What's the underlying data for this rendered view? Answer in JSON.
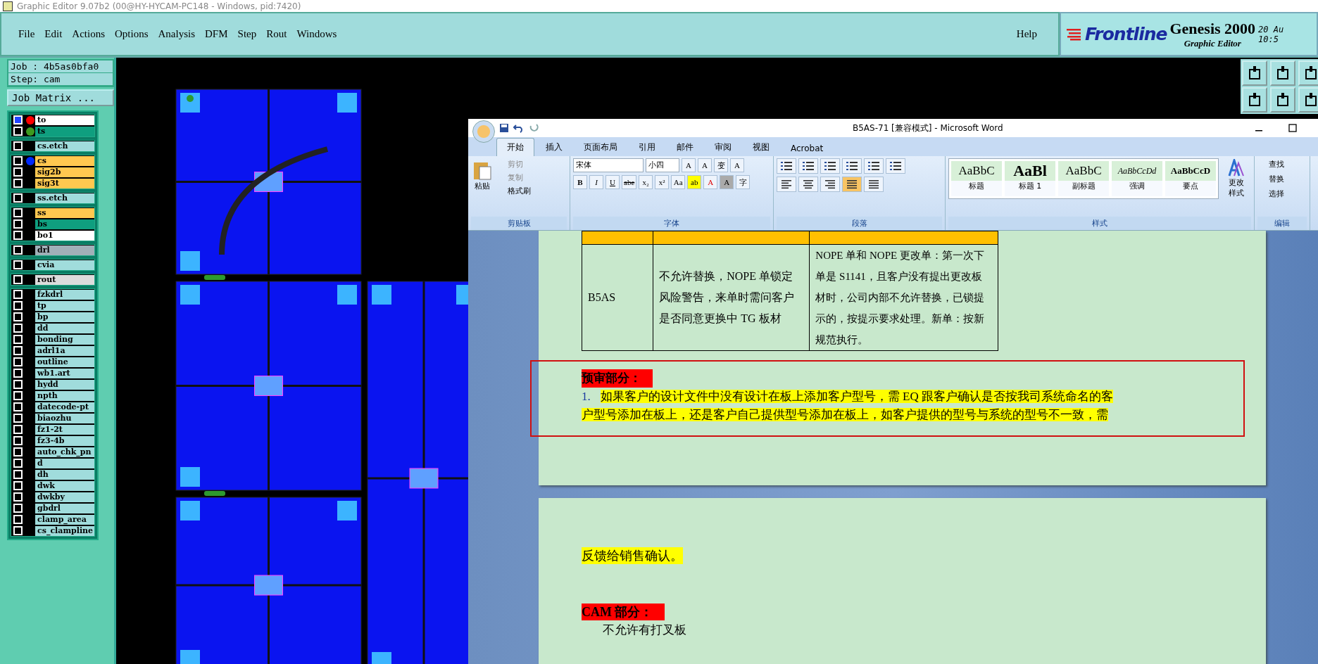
{
  "window": {
    "title": "Graphic Editor 9.07b2 (00@HY-HYCAM-PC148 - Windows, pid:7420)"
  },
  "menu": [
    "File",
    "Edit",
    "Actions",
    "Options",
    "Analysis",
    "DFM",
    "Step",
    "Rout",
    "Windows"
  ],
  "help": "Help",
  "brand": {
    "logo": "Frontline",
    "product": "Genesis 2000",
    "subtitle": "Graphic Editor",
    "date": "20 Au",
    "time": "10:5"
  },
  "job": {
    "job": "Job : 4b5as0bfa0",
    "step": "Step: cam",
    "matrix_button": "Job Matrix ..."
  },
  "layer_groups": [
    {
      "layers": [
        {
          "name": "to",
          "color": "#ffffff",
          "dot": {
            "color": "#ff0000"
          },
          "selected": true
        },
        {
          "name": "ts",
          "color": "#0f9f7f",
          "dot": {
            "color": "#3c9a1e"
          },
          "selected": false
        }
      ]
    },
    {
      "layers": [
        {
          "name": "cs.etch",
          "color": "#a0dcdc",
          "selected": false
        }
      ]
    },
    {
      "layers": [
        {
          "name": "cs",
          "color": "#ffc850",
          "dot": {
            "color": "#0028ff"
          },
          "selected": false
        },
        {
          "name": "sig2b",
          "color": "#ffc850",
          "selected": false
        },
        {
          "name": "sig3t",
          "color": "#ffc850",
          "selected": false
        }
      ]
    },
    {
      "layers": [
        {
          "name": "ss.etch",
          "color": "#a0dcdc",
          "selected": false
        }
      ]
    },
    {
      "layers": [
        {
          "name": "ss",
          "color": "#ffc850",
          "selected": false
        },
        {
          "name": "bs",
          "color": "#0f9f7f",
          "selected": false
        },
        {
          "name": "bo1",
          "color": "#ffffff",
          "selected": false
        }
      ]
    },
    {
      "layers": [
        {
          "name": "drl",
          "color": "#a0b0b8",
          "selected": false
        }
      ]
    },
    {
      "layers": [
        {
          "name": "cvia",
          "color": "#a0dcdc",
          "selected": false
        }
      ]
    },
    {
      "layers": [
        {
          "name": "rout",
          "color": "#dcdcdc",
          "selected": false
        }
      ]
    },
    {
      "layers": [
        {
          "name": "fzkdrl",
          "color": "#a0dcdc",
          "selected": false
        },
        {
          "name": "tp",
          "color": "#a0dcdc",
          "selected": false
        },
        {
          "name": "bp",
          "color": "#a0dcdc",
          "selected": false
        },
        {
          "name": "dd",
          "color": "#a0dcdc",
          "selected": false
        },
        {
          "name": "bonding",
          "color": "#a0dcdc",
          "selected": false
        },
        {
          "name": "adrl1a",
          "color": "#a0dcdc",
          "selected": false
        },
        {
          "name": "outline",
          "color": "#a0dcdc",
          "selected": false
        },
        {
          "name": "wb1.art",
          "color": "#a0dcdc",
          "selected": false
        },
        {
          "name": "hydd",
          "color": "#a0dcdc",
          "selected": false
        },
        {
          "name": "npth",
          "color": "#a0dcdc",
          "selected": false
        },
        {
          "name": "datecode-pt",
          "color": "#a0dcdc",
          "selected": false
        },
        {
          "name": "biaozhu",
          "color": "#a0dcdc",
          "selected": false
        },
        {
          "name": "fz1-2t",
          "color": "#a0dcdc",
          "selected": false
        },
        {
          "name": "fz3-4b",
          "color": "#a0dcdc",
          "selected": false
        },
        {
          "name": "auto_chk_pn",
          "color": "#a0dcdc",
          "selected": false
        },
        {
          "name": "d",
          "color": "#a0dcdc",
          "selected": false
        },
        {
          "name": "dh",
          "color": "#a0dcdc",
          "selected": false
        },
        {
          "name": "dwk",
          "color": "#a0dcdc",
          "selected": false
        },
        {
          "name": "dwkby",
          "color": "#a0dcdc",
          "selected": false
        },
        {
          "name": "gbdrl",
          "color": "#a0dcdc",
          "selected": false
        },
        {
          "name": "clamp_area",
          "color": "#a0dcdc",
          "selected": false
        },
        {
          "name": "cs_clampline",
          "color": "#a0dcdc",
          "selected": false
        }
      ]
    }
  ],
  "word": {
    "title": "B5AS-71 [兼容模式] - Microsoft Word",
    "tabs": [
      {
        "label": "开始",
        "selected": true
      },
      {
        "label": "插入",
        "selected": false
      },
      {
        "label": "页面布局",
        "selected": false
      },
      {
        "label": "引用",
        "selected": false
      },
      {
        "label": "邮件",
        "selected": false
      },
      {
        "label": "审阅",
        "selected": false
      },
      {
        "label": "视图",
        "selected": false
      },
      {
        "label": "Acrobat",
        "selected": false
      }
    ],
    "clipboard": {
      "label": "剪贴板",
      "paste": "粘贴",
      "items": [
        "剪切",
        "复制",
        "格式刷"
      ]
    },
    "font": {
      "label": "字体",
      "name": "宋体",
      "size": "小四",
      "row1": [
        "A",
        "A",
        "变",
        "A"
      ],
      "row2": [
        "B",
        "I",
        "U",
        "abe",
        "x₂",
        "x²",
        "Aa",
        "ab",
        "A",
        "A",
        "字"
      ]
    },
    "paragraph": {
      "label": "段落",
      "align": [
        {
          "selected": false
        },
        {
          "selected": false
        },
        {
          "selected": false
        },
        {
          "selected": true
        },
        {
          "selected": false
        }
      ]
    },
    "styles": {
      "label": "样式",
      "change": "更改样式",
      "items": [
        {
          "preview": "AaBbC",
          "label": "标题",
          "kind": "normal"
        },
        {
          "preview": "AaBl",
          "label": "标题 1",
          "kind": "heading"
        },
        {
          "preview": "AaBbC",
          "label": "副标题",
          "kind": "subtitle"
        },
        {
          "preview": "AaBbCcDd",
          "label": "强调",
          "kind": "emphasis"
        },
        {
          "preview": "AaBbCcD",
          "label": "要点",
          "kind": "strong"
        }
      ]
    },
    "editing": {
      "label": "编辑",
      "items": [
        "查找",
        "替换",
        "选择"
      ]
    },
    "table": {
      "rows": [
        [
          "B5AS",
          "不允许替换，NOPE 单锁定风险警告，来单时需问客户是否同意更换中 TG 板材",
          "NOPE 单和 NOPE 更改单：第一次下单是 S1141，且客户没有提出更改板材时，公司内部不允许替换，已锁提示的，按提示要求处理。新单：按新规范执行。"
        ]
      ]
    },
    "section_1": {
      "heading": "预审部分：",
      "number": "1.",
      "text": "如果客户的设计文件中没有设计在板上添加客户型号，需 EQ 跟客户确认是否按我司系统命名的客户型号添加在板上，还是客户自己提供型号添加在板上，如客户提供的型号与系统的型号不一致，需"
    },
    "page_2": {
      "continued": "反馈给销售确认。",
      "heading": "CAM 部分：",
      "text": "不允许有打叉板"
    }
  }
}
